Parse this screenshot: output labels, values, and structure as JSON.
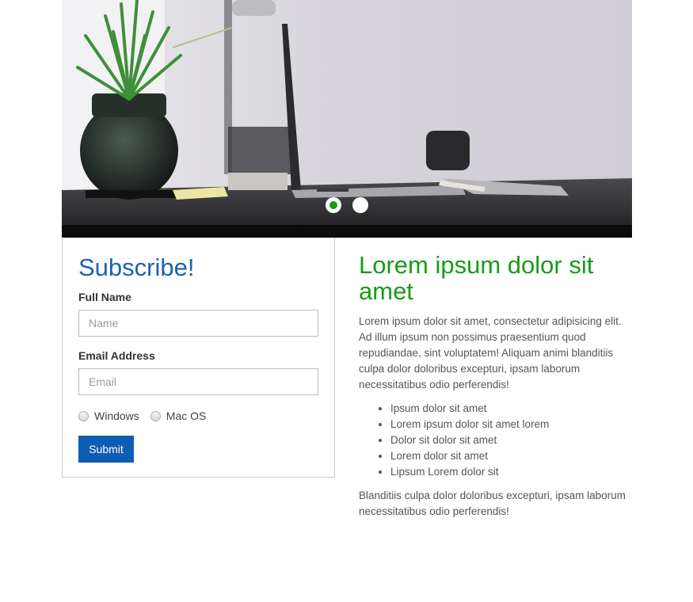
{
  "slider": {
    "image": "desk-laptop-plant-photo",
    "active_index": 0,
    "slide_count": 2
  },
  "subscribe": {
    "title": "Subscribe!",
    "name_label": "Full Name",
    "name_placeholder": "Name",
    "email_label": "Email Address",
    "email_placeholder": "Email",
    "os_options": [
      "Windows",
      "Mac OS"
    ],
    "submit_label": "Submit"
  },
  "content": {
    "title": "Lorem ipsum dolor sit amet",
    "paragraph1": "Lorem ipsum dolor sit amet, consectetur adipisicing elit. Ad illum ipsum non possimus praesentium quod repudiandae, sint voluptatem! Aliquam animi blanditiis culpa dolor doloribus excepturi, ipsam laborum necessitatibus odio perferendis!",
    "bullets": [
      "Ipsum dolor sit amet",
      "Lorem ipsum dolor sit amet lorem",
      "Dolor sit dolor sit amet",
      "Lorem dolor sit amet",
      "Lipsum Lorem dolor sit"
    ],
    "paragraph2": "Blanditiis culpa dolor doloribus excepturi, ipsam laborum necessitatibus odio perferendis!"
  },
  "colors": {
    "form_title": "#1b62b4",
    "content_title": "#1a9a1a",
    "submit_bg": "#0d5eb3",
    "active_dot": "#1a9a1a"
  }
}
